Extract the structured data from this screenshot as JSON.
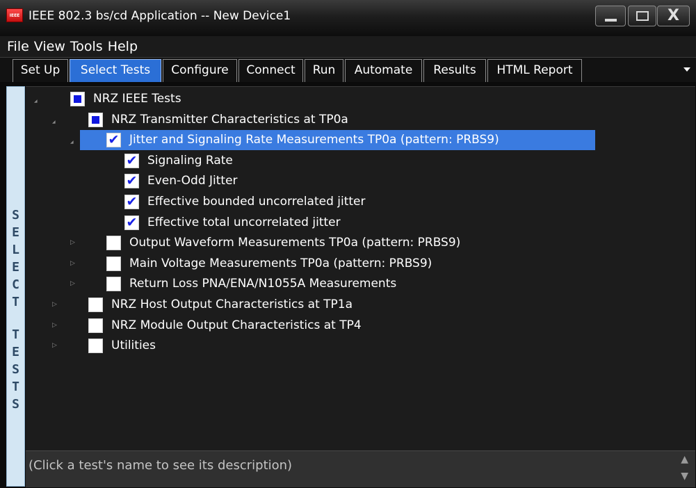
{
  "window": {
    "title": "IEEE 802.3 bs/cd Application -- New Device1",
    "icon_label": "IEEE",
    "close_glyph": "X"
  },
  "menu": {
    "items": [
      "File",
      "View",
      "Tools",
      "Help"
    ]
  },
  "tabs": {
    "items": [
      "Set Up",
      "Select Tests",
      "Configure",
      "Connect",
      "Run",
      "Automate",
      "Results",
      "HTML Report"
    ],
    "active": "Select Tests"
  },
  "side_label": "SELECT TESTS",
  "tree": {
    "rows": [
      {
        "label": "NRZ IEEE Tests",
        "state": "partial",
        "expanded": true
      },
      {
        "label": "NRZ Transmitter Characteristics at TP0a",
        "state": "partial",
        "expanded": true
      },
      {
        "label": "Jitter and Signaling Rate Measurements TP0a (pattern: PRBS9)",
        "state": "checked",
        "expanded": true,
        "selected": true
      },
      {
        "label": "Signaling Rate",
        "state": "checked"
      },
      {
        "label": "Even-Odd Jitter",
        "state": "checked"
      },
      {
        "label": "Effective bounded uncorrelated jitter",
        "state": "checked"
      },
      {
        "label": "Effective total uncorrelated jitter",
        "state": "checked"
      },
      {
        "label": "Output Waveform Measurements TP0a (pattern: PRBS9)",
        "state": "unchecked",
        "expanded": false
      },
      {
        "label": "Main Voltage Measurements TP0a (pattern: PRBS9)",
        "state": "unchecked",
        "expanded": false
      },
      {
        "label": "Return Loss PNA/ENA/N1055A Measurements",
        "state": "unchecked",
        "expanded": false
      },
      {
        "label": "NRZ Host Output Characteristics at TP1a",
        "state": "unchecked",
        "expanded": false
      },
      {
        "label": "NRZ Module Output Characteristics at TP4",
        "state": "unchecked",
        "expanded": false
      },
      {
        "label": "Utilities",
        "state": "unchecked",
        "expanded": false
      }
    ]
  },
  "description": {
    "text": "(Click a test's name to see its description)"
  },
  "colors": {
    "tab_active": "#2b6fd6",
    "selection": "#3a7be0",
    "partial_fill": "#1018e0",
    "check": "#1a22e6"
  }
}
